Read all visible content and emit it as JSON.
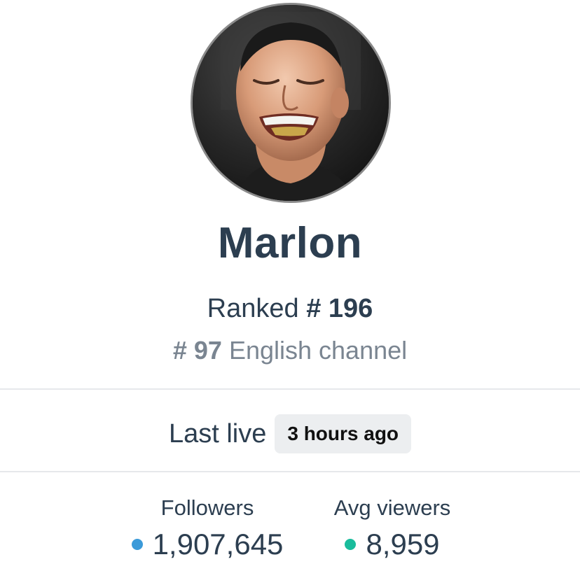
{
  "profile": {
    "name": "Marlon",
    "rank_prefix": "Ranked",
    "rank_value": "# 196",
    "language_rank_value": "# 97",
    "language_rank_suffix": "English channel"
  },
  "last_live": {
    "label": "Last live",
    "value": "3 hours ago"
  },
  "stats": {
    "followers": {
      "label": "Followers",
      "value": "1,907,645",
      "dot_color": "#3b9ad9"
    },
    "avg_viewers": {
      "label": "Avg viewers",
      "value": "8,959",
      "dot_color": "#1abc9c"
    }
  },
  "colors": {
    "text_primary": "#2c3e50",
    "text_secondary": "#7a8591",
    "badge_bg": "#eceef0",
    "divider": "#e6e8eb"
  }
}
